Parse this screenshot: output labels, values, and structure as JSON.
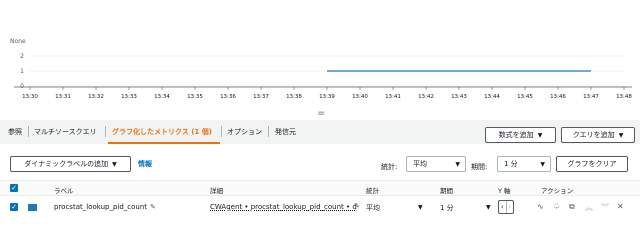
{
  "chart": {
    "unit_label": "None",
    "y_ticks": [
      "2",
      "1",
      "0"
    ],
    "x_ticks": [
      "13:30",
      "13:31",
      "13:32",
      "13:33",
      "13:34",
      "13:35",
      "13:36",
      "13:37",
      "13:38",
      "13:39",
      "13:40",
      "13:41",
      "13:42",
      "13:43",
      "13:44",
      "13:45",
      "13:46",
      "13:47",
      "13:48"
    ],
    "line_color": "#1f77b4"
  },
  "chart_data": {
    "type": "line",
    "title": "",
    "xlabel": "",
    "ylabel": "None",
    "x_ticks": [
      "13:30",
      "13:31",
      "13:32",
      "13:33",
      "13:34",
      "13:35",
      "13:36",
      "13:37",
      "13:38",
      "13:39",
      "13:40",
      "13:41",
      "13:42",
      "13:43",
      "13:44",
      "13:45",
      "13:46",
      "13:47",
      "13:48"
    ],
    "ylim": [
      0,
      2
    ],
    "y_ticks": [
      0,
      1,
      2
    ],
    "series": [
      {
        "name": "procstat_lookup_pid_count",
        "color": "#1f77b4",
        "x": [
          "13:39",
          "13:40",
          "13:41",
          "13:42",
          "13:43",
          "13:44",
          "13:45",
          "13:46",
          "13:47"
        ],
        "y": [
          1,
          1,
          1,
          1,
          1,
          1,
          1,
          1,
          1
        ]
      }
    ],
    "grid": "horizontal"
  },
  "splitter": {
    "handle": "="
  },
  "tabs": [
    {
      "label": "参照",
      "active": false
    },
    {
      "label": "マルチソースクエリ",
      "active": false
    },
    {
      "label": "グラフ化したメトリクス (1 個)",
      "active": true
    },
    {
      "label": "オプション",
      "active": false
    },
    {
      "label": "発信元",
      "active": false
    }
  ],
  "toolbar": {
    "add_formula": "数式を追加",
    "add_query": "クエリを追加"
  },
  "options": {
    "dynamic_label": "ダイナミックラベルの追加",
    "info": "情報",
    "statistic_label": "統計:",
    "statistic_value": "平均",
    "period_label": "期間:",
    "period_value": "1 分",
    "clear_graph": "グラフをクリア"
  },
  "table": {
    "headers": {
      "label": "ラベル",
      "details": "詳細",
      "statistic": "統計",
      "period": "期間",
      "y_axis": "Y 軸",
      "actions": "アクション"
    },
    "rows": [
      {
        "label": "procstat_lookup_pid_count",
        "details": "CWAgent • procstat_lookup_pid_count • d",
        "statistic": "平均",
        "period": "1 分",
        "color": "#1f77b4",
        "checked": true
      }
    ]
  },
  "colors": {
    "accent": "#ec7211",
    "link": "#0073bb",
    "series": "#1f77b4"
  }
}
